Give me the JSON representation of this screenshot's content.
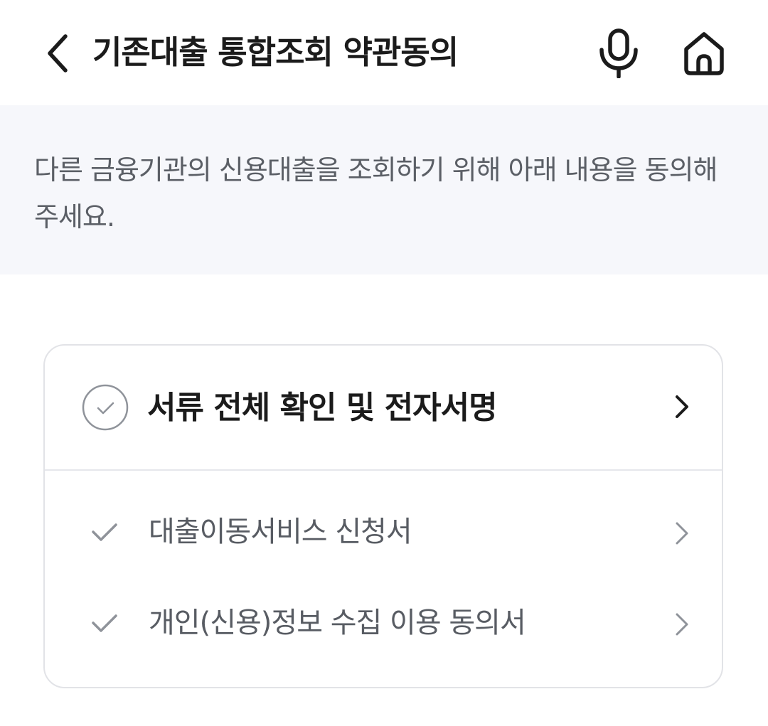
{
  "header": {
    "title": "기존대출 통합조회 약관동의",
    "back_icon": "chevron-left-icon",
    "mic_icon": "microphone-icon",
    "home_icon": "home-icon"
  },
  "notice": {
    "text": "다른 금융기관의 신용대출을 조회하기 위해 아래 내용을 동의해주세요."
  },
  "agreement": {
    "all_label": "서류 전체 확인 및 전자서명",
    "documents": [
      {
        "label": "대출이동서비스 신청서"
      },
      {
        "label": "개인(신용)정보 수집 이용 동의서"
      }
    ]
  },
  "colors": {
    "notice_bg": "#f6f7fb",
    "card_border": "#e2e3e7",
    "muted_text": "#585c63",
    "check_gray": "#8f939a"
  }
}
